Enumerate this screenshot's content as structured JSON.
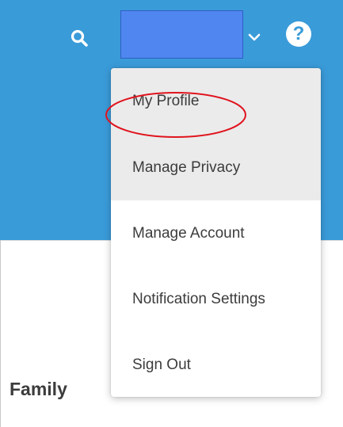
{
  "header": {
    "background_color": "#3a9bd9",
    "search_icon": "search-icon",
    "account_name_redacted_color": "#4f86f0",
    "chevron_icon": "chevron-down-icon",
    "help_icon_glyph": "?"
  },
  "user_menu": {
    "items": [
      {
        "label": "My Profile",
        "highlighted": true
      },
      {
        "label": "Manage Privacy",
        "highlighted": true
      },
      {
        "label": "Manage Account",
        "highlighted": false
      },
      {
        "label": "Notification Settings",
        "highlighted": false
      },
      {
        "label": "Sign Out",
        "highlighted": false
      }
    ]
  },
  "annotation": {
    "target": "My Profile",
    "color": "#e0141e"
  },
  "page": {
    "section_heading": "Family"
  }
}
